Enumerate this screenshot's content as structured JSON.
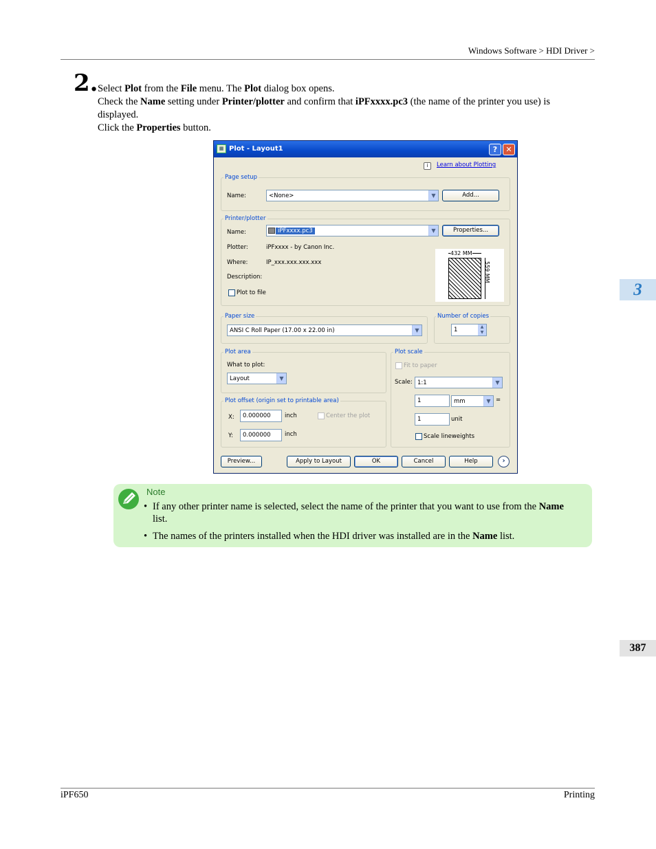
{
  "header": {
    "breadcrumb": "Windows Software > HDI Driver >"
  },
  "footer": {
    "model": "iPF650",
    "section": "Printing"
  },
  "side": {
    "chapter": "3",
    "page": "387"
  },
  "step": {
    "number": "2.",
    "line1": [
      "Select ",
      "Plot",
      " from the ",
      "File",
      " menu. The ",
      "Plot",
      " dialog box opens."
    ],
    "line2": [
      "Check the ",
      "Name",
      " setting under ",
      "Printer/plotter",
      " and confirm that ",
      "iPFxxxx.pc3",
      " (the name of the printer you use) is displayed."
    ],
    "line3": [
      "Click the ",
      "Properties",
      " button."
    ]
  },
  "dialog": {
    "title": "Plot - Layout1",
    "title_icon": "autocad-plot-icon",
    "help_btn": "?",
    "close_btn": "✕",
    "learn_link": "Learn about Plotting",
    "page_setup": {
      "label": "Page setup",
      "name_label": "Name:",
      "name_value": "<None>",
      "add_btn": "Add..."
    },
    "printer": {
      "label": "Printer/plotter",
      "name_label": "Name:",
      "name_value": "iPFxxxx.pc3",
      "properties_btn": "Properties...",
      "plotter_label": "Plotter:",
      "plotter_value": "iPFxxxx - by Canon Inc.",
      "where_label": "Where:",
      "where_value": "IP_xxx.xxx.xxx.xxx",
      "description_label": "Description:",
      "plot_to_file": "Plot to file",
      "preview_width": "432 MM",
      "preview_height": "559 MM"
    },
    "paper_size": {
      "label": "Paper size",
      "value": "ANSI C Roll Paper (17.00 x 22.00 in)"
    },
    "copies": {
      "label": "Number of copies",
      "value": "1"
    },
    "plot_area": {
      "label": "Plot area",
      "what_label": "What to plot:",
      "what_value": "Layout"
    },
    "plot_scale": {
      "label": "Plot scale",
      "fit": "Fit to paper",
      "scale_label": "Scale:",
      "scale_value": "1:1",
      "value1": "1",
      "unit_value": "mm",
      "equals": "=",
      "value2": "1",
      "unit_label": "unit",
      "lineweights": "Scale lineweights"
    },
    "plot_offset": {
      "label": "Plot offset (origin set to printable area)",
      "x_label": "X:",
      "x_value": "0.000000",
      "x_unit": "inch",
      "y_label": "Y:",
      "y_value": "0.000000",
      "y_unit": "inch",
      "center": "Center the plot"
    },
    "buttons": {
      "preview": "Preview...",
      "apply": "Apply to Layout",
      "ok": "OK",
      "cancel": "Cancel",
      "help": "Help"
    }
  },
  "note": {
    "title": "Note",
    "item1": [
      "If any other printer name is selected, select the name of the printer that you want to use from the ",
      "Name",
      " list."
    ],
    "item2": [
      "The names of the printers installed when the HDI driver was installed are in the ",
      "Name",
      " list."
    ]
  }
}
